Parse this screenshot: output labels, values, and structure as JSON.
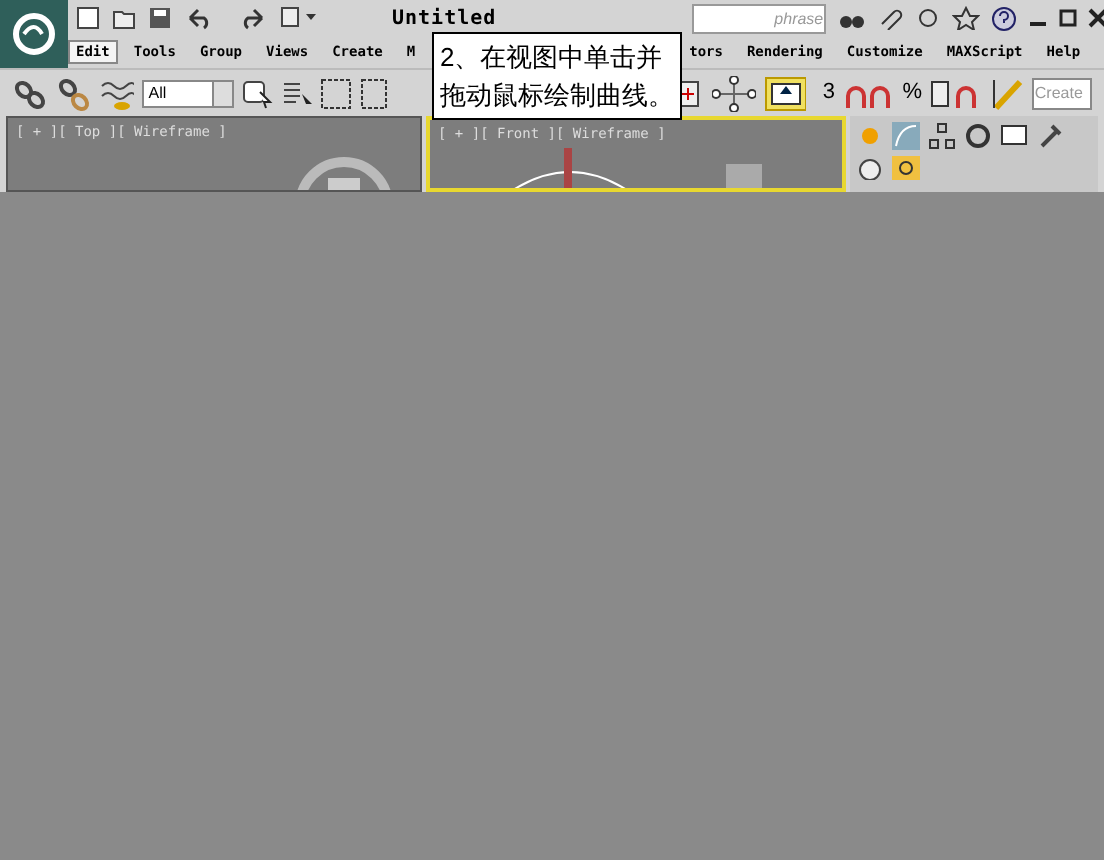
{
  "title_bar": {
    "title": "Untitled",
    "search": {
      "placeholder": "phrase"
    }
  },
  "menu": [
    {
      "label": "Edit",
      "selected": true
    },
    {
      "label": "Tools",
      "selected": false
    },
    {
      "label": "Group",
      "selected": false
    },
    {
      "label": "Views",
      "selected": false
    },
    {
      "label": "Create",
      "selected": false
    },
    {
      "label": "M",
      "selected": false
    },
    {
      "label": "tors",
      "selected": false
    },
    {
      "label": "Rendering",
      "selected": false
    },
    {
      "label": "Customize",
      "selected": false
    },
    {
      "label": "MAXScript",
      "selected": false
    },
    {
      "label": "Help",
      "selected": false
    }
  ],
  "toolbar": {
    "selection_filter": "All",
    "snap_label": "3",
    "percent_label": "%",
    "named_selection": "Create"
  },
  "viewports": [
    {
      "label": "[ + ][ Top ][ Wireframe ]",
      "selected": false
    },
    {
      "label": "[ + ][ Front ][ Wireframe ]",
      "selected": true
    }
  ],
  "callout": {
    "lines": [
      "2、在视图中单击并",
      "拖动鼠标绘制曲线。"
    ]
  }
}
